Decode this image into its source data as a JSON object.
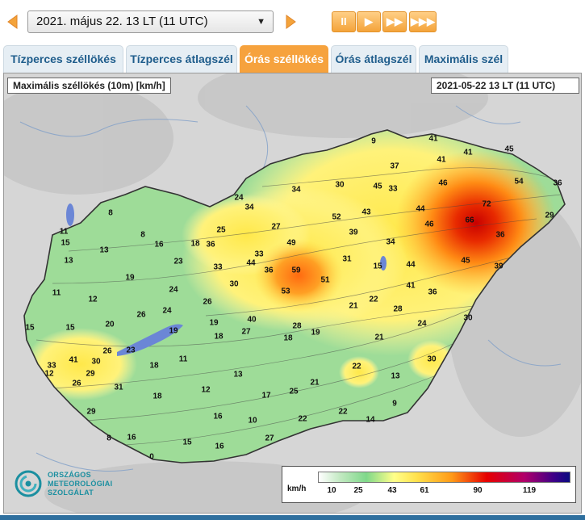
{
  "toolbar": {
    "prev_label": "◀",
    "date_value": "2021. május 22. 13 LT (11  UTC)",
    "next_label": "▶",
    "pause_label": "II",
    "play_label": "▶",
    "fast_label": "▶▶",
    "faster_label": "▶▶▶"
  },
  "tabs": [
    {
      "label": "Tízperces széllökés",
      "active": false
    },
    {
      "label": "Tízperces átlagszél",
      "active": false
    },
    {
      "label": "Órás széllökés",
      "active": true
    },
    {
      "label": "Órás átlagszél",
      "active": false
    },
    {
      "label": "Maximális szél",
      "active": false
    }
  ],
  "map": {
    "title": "Maximális széllökés (10m) [km/h]",
    "timestamp": "2021-05-22 13 LT  (11 UTC)",
    "stations": [
      {
        "v": "9"
      },
      {
        "v": "41"
      },
      {
        "v": "41"
      },
      {
        "v": "45"
      },
      {
        "v": "37"
      },
      {
        "v": "41"
      },
      {
        "v": "30"
      },
      {
        "v": "45"
      },
      {
        "v": "33"
      },
      {
        "v": "46"
      },
      {
        "v": "54"
      },
      {
        "v": "36"
      },
      {
        "v": "34"
      },
      {
        "v": "72"
      },
      {
        "v": "24"
      },
      {
        "v": "34"
      },
      {
        "v": "52"
      },
      {
        "v": "43"
      },
      {
        "v": "44"
      },
      {
        "v": "66"
      },
      {
        "v": "29"
      },
      {
        "v": "8"
      },
      {
        "v": "25"
      },
      {
        "v": "27"
      },
      {
        "v": "39"
      },
      {
        "v": "46"
      },
      {
        "v": "11"
      },
      {
        "v": "15"
      },
      {
        "v": "8"
      },
      {
        "v": "18"
      },
      {
        "v": "36"
      },
      {
        "v": "49"
      },
      {
        "v": "34"
      },
      {
        "v": "36"
      },
      {
        "v": "16"
      },
      {
        "v": "13"
      },
      {
        "v": "33"
      },
      {
        "v": "44"
      },
      {
        "v": "33"
      },
      {
        "v": "31"
      },
      {
        "v": "15"
      },
      {
        "v": "45"
      },
      {
        "v": "39"
      },
      {
        "v": "13"
      },
      {
        "v": "23"
      },
      {
        "v": "36"
      },
      {
        "v": "59"
      },
      {
        "v": "44"
      },
      {
        "v": "19"
      },
      {
        "v": "51"
      },
      {
        "v": "30"
      },
      {
        "v": "41"
      },
      {
        "v": "11"
      },
      {
        "v": "24"
      },
      {
        "v": "53"
      },
      {
        "v": "36"
      },
      {
        "v": "12"
      },
      {
        "v": "26"
      },
      {
        "v": "21"
      },
      {
        "v": "22"
      },
      {
        "v": "28"
      },
      {
        "v": "26"
      },
      {
        "v": "24"
      },
      {
        "v": "40"
      },
      {
        "v": "30"
      },
      {
        "v": "20"
      },
      {
        "v": "19"
      },
      {
        "v": "19"
      },
      {
        "v": "18"
      },
      {
        "v": "27"
      },
      {
        "v": "28"
      },
      {
        "v": "24"
      },
      {
        "v": "15"
      },
      {
        "v": "15"
      },
      {
        "v": "18"
      },
      {
        "v": "19"
      },
      {
        "v": "21"
      },
      {
        "v": "23"
      },
      {
        "v": "26"
      },
      {
        "v": "33"
      },
      {
        "v": "41"
      },
      {
        "v": "30"
      },
      {
        "v": "11"
      },
      {
        "v": "30"
      },
      {
        "v": "12"
      },
      {
        "v": "18"
      },
      {
        "v": "29"
      },
      {
        "v": "26"
      },
      {
        "v": "13"
      },
      {
        "v": "13"
      },
      {
        "v": "31"
      },
      {
        "v": "12"
      },
      {
        "v": "21"
      },
      {
        "v": "22"
      },
      {
        "v": "18"
      },
      {
        "v": "17"
      },
      {
        "v": "25"
      },
      {
        "v": "9"
      },
      {
        "v": "29"
      },
      {
        "v": "16"
      },
      {
        "v": "10"
      },
      {
        "v": "22"
      },
      {
        "v": "22"
      },
      {
        "v": "14"
      },
      {
        "v": "8"
      },
      {
        "v": "16"
      },
      {
        "v": "15"
      },
      {
        "v": "16"
      },
      {
        "v": "27"
      },
      {
        "v": "0"
      }
    ]
  },
  "legend": {
    "unit": "km/h",
    "ticks": [
      "10",
      "25",
      "43",
      "61",
      "90",
      "119"
    ]
  },
  "logo": {
    "line1": "ORSZÁGOS",
    "line2": "METEOROLÓGIAI",
    "line3": "SZOLGÁLAT"
  }
}
